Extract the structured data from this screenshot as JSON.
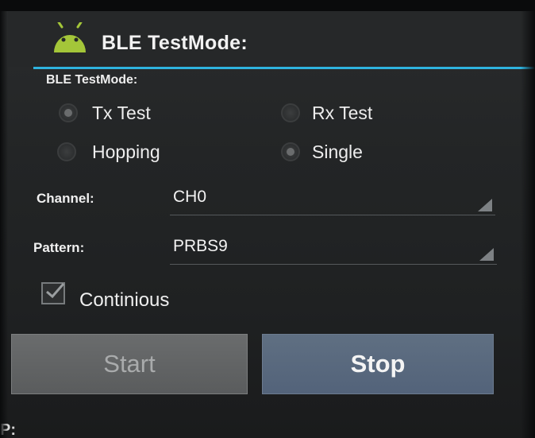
{
  "header": {
    "title": "BLE TestMode:",
    "icon": "android-icon",
    "accent_color": "#2fb3df"
  },
  "test_mode": {
    "section_label": "BLE TestMode:",
    "options": [
      {
        "label": "Tx Test",
        "checked": true
      },
      {
        "label": "Rx Test",
        "checked": false
      },
      {
        "label": "Hopping",
        "checked": false
      },
      {
        "label": "Single",
        "checked": true
      }
    ]
  },
  "channel": {
    "label": "Channel:",
    "value": "CH0"
  },
  "pattern": {
    "label": "Pattern:",
    "value": "PRBS9"
  },
  "continuous": {
    "label": "Continious",
    "checked": true
  },
  "buttons": {
    "start_label": "Start",
    "stop_label": "Stop"
  },
  "footer": {
    "cutoff_text": "P:"
  }
}
